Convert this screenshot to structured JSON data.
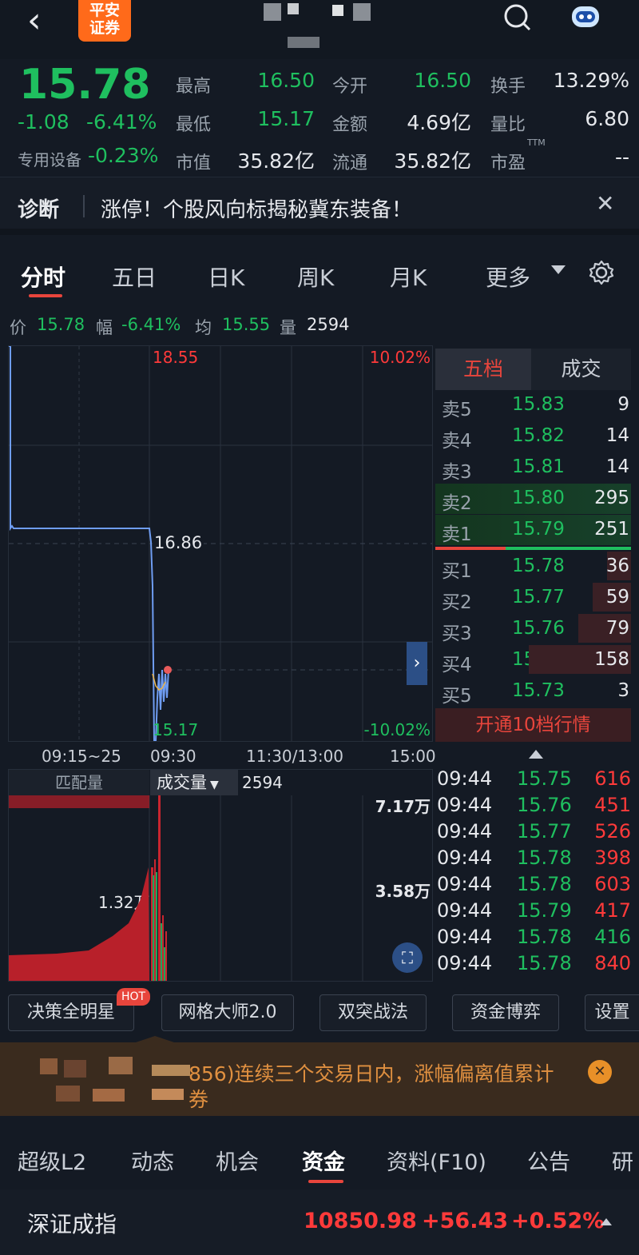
{
  "header": {
    "back": "‹",
    "brand_line1": "平安",
    "brand_line2": "证券"
  },
  "quote": {
    "price": "15.78",
    "change": "-1.08",
    "change_pct": "-6.41%",
    "sector": "专用设备",
    "sector_pct": "-0.23%",
    "stats": [
      {
        "label": "最高",
        "value": "16.50"
      },
      {
        "label": "今开",
        "value": "16.50"
      },
      {
        "label": "换手",
        "value": "13.29%"
      },
      {
        "label": "最低",
        "value": "15.17"
      },
      {
        "label": "金额",
        "value": "4.69亿"
      },
      {
        "label": "量比",
        "value": "6.80"
      },
      {
        "label": "市值",
        "value": "35.82亿"
      },
      {
        "label": "流通",
        "value": "35.82亿"
      },
      {
        "label": "市盈",
        "value": "--"
      }
    ],
    "ttm": "TTM"
  },
  "diagnosis": {
    "label": "诊断",
    "text": "涨停！个股风向标揭秘冀东装备！",
    "close": "✕"
  },
  "chart_tabs": [
    "分时",
    "五日",
    "日K",
    "周K",
    "月K",
    "更多"
  ],
  "info_bar": {
    "price_label": "价",
    "price": "15.78",
    "amp_label": "幅",
    "amp": "-6.41%",
    "avg_label": "均",
    "avg": "15.55",
    "vol_label": "量",
    "vol": "2594"
  },
  "chart": {
    "top_price": "18.55",
    "top_pct": "10.02%",
    "mid_price": "16.86",
    "bottom_price": "15.17",
    "bottom_pct": "-10.02%",
    "time_labels": [
      "09:15~25",
      "09:30",
      "11:30/13:00",
      "15:00"
    ]
  },
  "volume": {
    "match_label": "匹配量",
    "vol_label": "成交量",
    "vol_value": "2594",
    "max_label": "7.17万",
    "mid_label": "3.58万",
    "auction_label": "1.32万"
  },
  "order_book": {
    "tabs": [
      "五档",
      "成交"
    ],
    "sells": [
      {
        "label": "卖5",
        "price": "15.83",
        "qty": "9"
      },
      {
        "label": "卖4",
        "price": "15.82",
        "qty": "14"
      },
      {
        "label": "卖3",
        "price": "15.81",
        "qty": "14"
      },
      {
        "label": "卖2",
        "price": "15.80",
        "qty": "295"
      },
      {
        "label": "卖1",
        "price": "15.79",
        "qty": "251"
      }
    ],
    "buys": [
      {
        "label": "买1",
        "price": "15.78",
        "qty": "36"
      },
      {
        "label": "买2",
        "price": "15.77",
        "qty": "59"
      },
      {
        "label": "买3",
        "price": "15.76",
        "qty": "79"
      },
      {
        "label": "买4",
        "price": "15.75",
        "qty": "158"
      },
      {
        "label": "买5",
        "price": "15.73",
        "qty": "3"
      }
    ],
    "upgrade": "开通10档行情"
  },
  "trades": [
    {
      "time": "09:44",
      "price": "15.75",
      "qty": "616"
    },
    {
      "time": "09:44",
      "price": "15.76",
      "qty": "451"
    },
    {
      "time": "09:44",
      "price": "15.77",
      "qty": "526"
    },
    {
      "time": "09:44",
      "price": "15.78",
      "qty": "398"
    },
    {
      "time": "09:44",
      "price": "15.78",
      "qty": "603"
    },
    {
      "time": "09:44",
      "price": "15.79",
      "qty": "417"
    },
    {
      "time": "09:44",
      "price": "15.78",
      "qty": "416"
    },
    {
      "time": "09:44",
      "price": "15.78",
      "qty": "840"
    }
  ],
  "tools": [
    {
      "label": "决策全明星",
      "badge": "HOT"
    },
    {
      "label": "网格大师2.0"
    },
    {
      "label": "双突战法"
    },
    {
      "label": "资金博弈"
    },
    {
      "label": "设置"
    }
  ],
  "banner": {
    "line1": "856)连续三个交易日内，涨幅偏离值累计",
    "line2": "券"
  },
  "bottom_tabs": [
    "超级L2",
    "动态",
    "机会",
    "资金",
    "资料(F10)",
    "公告",
    "研"
  ],
  "index": {
    "name": "深证成指",
    "value": "10850.98",
    "change": "+56.43",
    "pct": "+0.52%"
  },
  "colors": {
    "up": "#ff3a3a",
    "down": "#1fbf5f",
    "accent": "#e8453c",
    "brand": "#ff6a1a"
  }
}
